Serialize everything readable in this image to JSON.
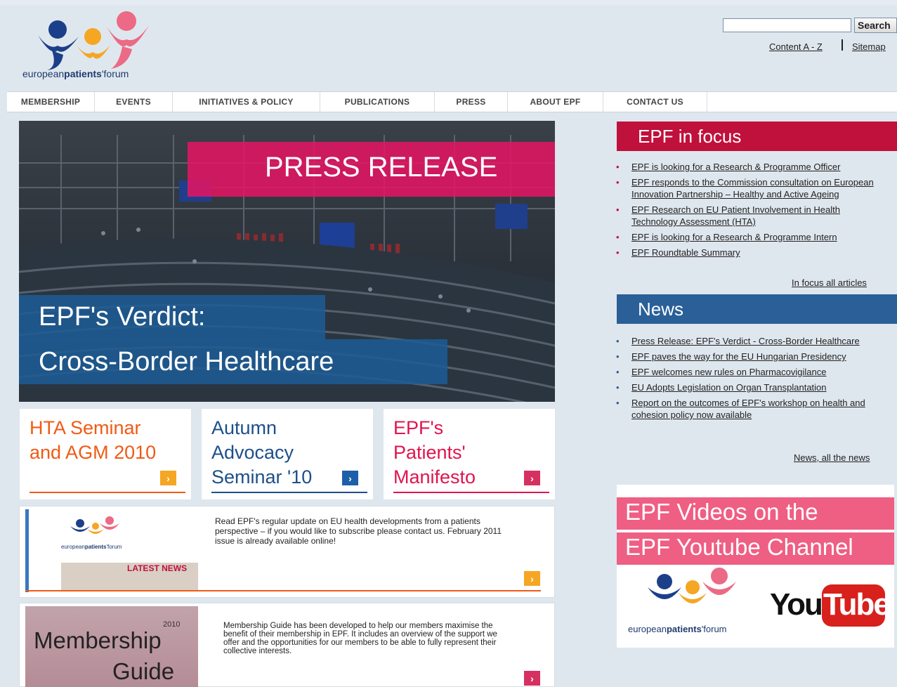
{
  "header": {
    "logo_text_regular_1": "european",
    "logo_text_bold": "patients",
    "logo_text_regular_2": "'forum",
    "search_placeholder": "",
    "search_button": "Search",
    "util_links": [
      "Content A - Z",
      "Sitemap"
    ]
  },
  "nav": {
    "items": [
      "MEMBERSHIP",
      "EVENTS",
      "INITIATIVES & POLICY",
      "PUBLICATIONS",
      "PRESS",
      "ABOUT EPF",
      "CONTACT US"
    ]
  },
  "hero": {
    "press_label": "PRESS RELEASE",
    "headline_1": "EPF's Verdict:",
    "headline_2": "Cross-Border Healthcare"
  },
  "promos": [
    {
      "title": "HTA Seminar and AGM 2010",
      "color": "#f05a14"
    },
    {
      "title": "Autumn Advocacy Seminar '10",
      "color": "#1e4f8a"
    },
    {
      "title": "EPF's Patients' Manifesto",
      "color": "#e0144f"
    }
  ],
  "newsletter": {
    "thumb_logo_regular": "european",
    "thumb_logo_bold": "patients",
    "thumb_logo_tail": "'forum",
    "thumb_label": "LATEST NEWS",
    "text": "Read EPF's regular update on EU health developments from a patients perspective – if you would like to subscribe please contact us. February 2011 issue is already available online!"
  },
  "membership": {
    "thumb_year": "2010",
    "thumb_title_1": "Membership",
    "thumb_title_2": "Guide",
    "text": "Membership Guide has been developed to help our members maximise the benefit of their membership in EPF. It includes an overview of the support we offer and the opportunities for our members to be able to fully represent their collective interests."
  },
  "focus": {
    "title": "EPF in focus",
    "items": [
      "EPF is looking for a Research & Programme Officer",
      "EPF responds to the Commission consultation on European Innovation Partnership – Healthy and Active Ageing",
      "EPF Research on EU Patient Involvement in Health Technology Assessment (HTA)",
      "EPF is looking for a Research & Programme Intern",
      "EPF Roundtable Summary"
    ],
    "more": "In focus all articles"
  },
  "news": {
    "title": "News",
    "items": [
      "Press Release: EPF's Verdict - Cross-Border Healthcare",
      "EPF paves the way for the EU Hungarian Presidency",
      "EPF welcomes new rules on Pharmacovigilance",
      "EU Adopts Legislation on Organ Transplantation",
      "Report on the outcomes of EPF's workshop on health and cohesion policy now available"
    ],
    "more": "News, all the news"
  },
  "video": {
    "line_1": "EPF Videos on the",
    "line_2": "EPF Youtube Channel",
    "logo_regular": "european",
    "logo_bold": "patients",
    "logo_tail": "'forum",
    "yt_you": "You",
    "yt_tube": "Tube"
  },
  "colors": {
    "focus_header": "#c0103c",
    "news_header": "#2a5f98",
    "accent_orange": "#f5a623",
    "accent_blue": "#1e5fa8",
    "accent_pink": "#d63060"
  }
}
